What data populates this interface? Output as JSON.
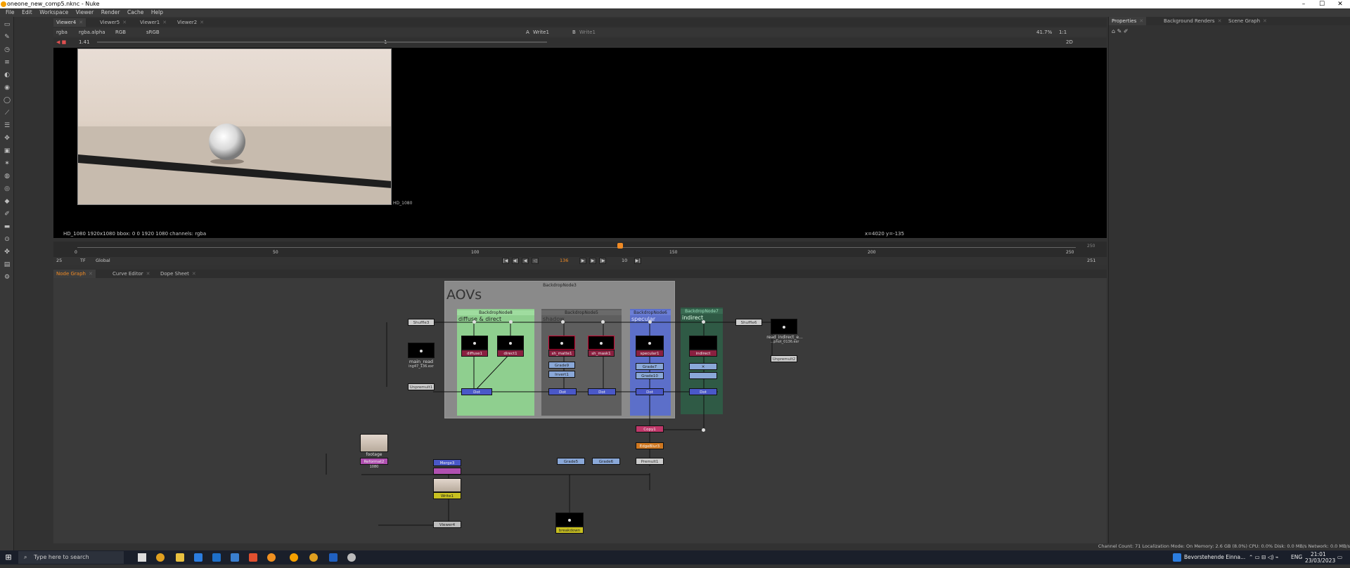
{
  "window": {
    "title": "oneone_new_comp5.nknc - Nuke",
    "minimize": "–",
    "maximize": "☐",
    "close": "✕"
  },
  "menu": [
    "File",
    "Edit",
    "Workspace",
    "Viewer",
    "Render",
    "Cache",
    "Help"
  ],
  "viewer_tabs": [
    "Viewer4",
    "Viewer5",
    "Viewer1",
    "Viewer2"
  ],
  "viewer_controls": {
    "channels": "rgba",
    "alpha": "rgba.alpha",
    "colorspace": "RGB",
    "lut": "sRGB",
    "input_a": "Write1",
    "input_b": "Write1",
    "zoom": "41.7%",
    "ratio": "1:1",
    "view_mode": "2D",
    "gain": "1.41",
    "gamma": "1"
  },
  "viewer": {
    "format_label": "HD_1080",
    "info": "HD_1080 1920x1080  bbox: 0 0 1920 1080 channels: rgba",
    "coords": "x=4020 y=-135"
  },
  "timeline": {
    "ticks": [
      "0",
      "50",
      "100",
      "150",
      "200",
      "250"
    ],
    "start": "0",
    "end": "250",
    "range_end": "251",
    "fps": "25",
    "step": "TF",
    "scope": "Global",
    "current_frame": "136",
    "increment": "10"
  },
  "panel_tabs": [
    "Node Graph",
    "Curve Editor",
    "Dope Sheet"
  ],
  "right_tabs": [
    "Properties",
    "Background Renders",
    "Scene Graph"
  ],
  "nodegraph": {
    "main_backdrop": "BackdropNode3",
    "aov_title": "AOVs",
    "backdrops": [
      {
        "name": "BackdropNode8",
        "label": "diffuse & direct",
        "color": "#8fcf8f"
      },
      {
        "name": "BackdropNode5",
        "label": "shadow",
        "color": "#5e5e5e"
      },
      {
        "name": "BackdropNode6",
        "label": "specular",
        "color": "#5c6fc9"
      },
      {
        "name": "BackdropNode7",
        "label": "indirect",
        "color": "#2f5a45"
      }
    ],
    "nodes": {
      "diffuse": "diffuse1",
      "direct": "direct1",
      "sh_matte": "sh_matte1",
      "sh_mask": "sh_mask1",
      "specular": "specular1",
      "indirect": "indirect",
      "grade9": "Grade9",
      "invert": "Invert1",
      "grade7": "Grade7",
      "grade10": "Grade10",
      "copy": "Copy1",
      "edgeblur": "EdgeBlur3",
      "premult": "Premult1",
      "footage": "footage",
      "reformat": "Reformat2",
      "grade5": "Grade5",
      "grade6": "Grade6",
      "merge": "Merge3",
      "write": "Write1",
      "viewer": "Viewer4",
      "breakdown": "breakdown",
      "main_read": "main_read",
      "main_read_sub": "ing47_136.exr",
      "dot_shuffle": "Dot",
      "read_indirect": "read_indirect_e...",
      "read_indirect_sub": "...phot_0136.exr",
      "reformat_sub": "1080",
      "shuffle_left": "Shuffle3",
      "shuffle_right": "Shuffle6",
      "unpremult_left": "Unpremult1",
      "unpremult_right": "Unpremult2"
    }
  },
  "status": "Channel Count: 71  Localization Mode: On  Memory: 2.6 GB (8.0%)  CPU: 0.0%  Disk: 0.0 MB/s  Network: 0.0 MB/s",
  "taskbar": {
    "search_placeholder": "Type here to search",
    "notification": "Bevorstehende Einna...",
    "lang": "ENG",
    "time": "21:01",
    "date": "23/03/2023"
  }
}
